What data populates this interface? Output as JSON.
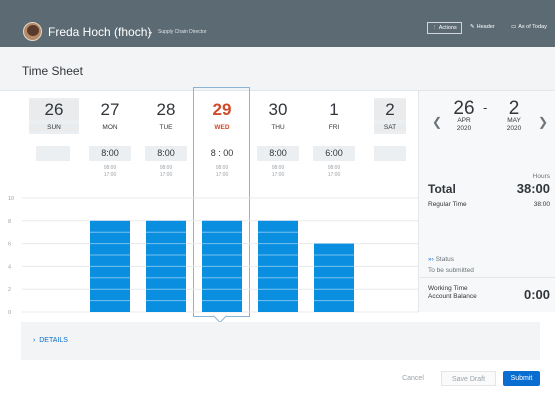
{
  "header": {
    "user_name": "Freda Hoch (fhoch)",
    "user_role": "Supply Chain Director",
    "actions_label": "Actions",
    "header_link_label": "Header",
    "as_of_label": "As of Today"
  },
  "page": {
    "title": "Time Sheet"
  },
  "days": [
    {
      "num": "26",
      "weekday": "SUN",
      "hours": "",
      "start": "",
      "end": "",
      "weekend": true
    },
    {
      "num": "27",
      "weekday": "MON",
      "hours": "8:00",
      "start": "08:00",
      "end": "17:00"
    },
    {
      "num": "28",
      "weekday": "TUE",
      "hours": "8:00",
      "start": "08:00",
      "end": "17:00"
    },
    {
      "num": "29",
      "weekday": "WED",
      "hours": "8 : 00",
      "start": "08:00",
      "end": "17:00",
      "today": true
    },
    {
      "num": "30",
      "weekday": "THU",
      "hours": "8:00",
      "start": "08:00",
      "end": "17:00"
    },
    {
      "num": "1",
      "weekday": "FRI",
      "hours": "6:00",
      "start": "08:00",
      "end": "17:00"
    },
    {
      "num": "2",
      "weekday": "SAT",
      "hours": "",
      "start": "",
      "end": "",
      "weekend": true
    }
  ],
  "chart_data": {
    "type": "bar",
    "categories": [
      "SUN",
      "MON",
      "TUE",
      "WED",
      "THU",
      "FRI",
      "SAT"
    ],
    "values": [
      0,
      8,
      8,
      8,
      8,
      6,
      0
    ],
    "ylim": [
      0,
      10
    ],
    "yticks": [
      "10",
      "8",
      "6",
      "4",
      "2",
      "0"
    ],
    "bar_color": "#0a8fe0",
    "grid": true
  },
  "range": {
    "start_day": "26",
    "start_month": "APR",
    "start_year": "2020",
    "separator": "-",
    "end_day": "2",
    "end_month": "MAY",
    "end_year": "2020"
  },
  "summary": {
    "hours_caption": "Hours",
    "total_label": "Total",
    "total_value": "38:00",
    "regular_label": "Regular Time",
    "regular_value": "38:00",
    "status_label": "Status",
    "status_value": "To be submitted",
    "wtab_label_1": "Working Time",
    "wtab_label_2": "Account Balance",
    "wtab_value": "0:00"
  },
  "details": {
    "label": "DETAILS"
  },
  "footer": {
    "cancel_label": "Cancel",
    "save_draft_label": "Save Draft",
    "submit_label": "Submit"
  },
  "colors": {
    "accent": "#0a6ed1",
    "today": "#d04b2b",
    "shell": "#5b6a73"
  }
}
